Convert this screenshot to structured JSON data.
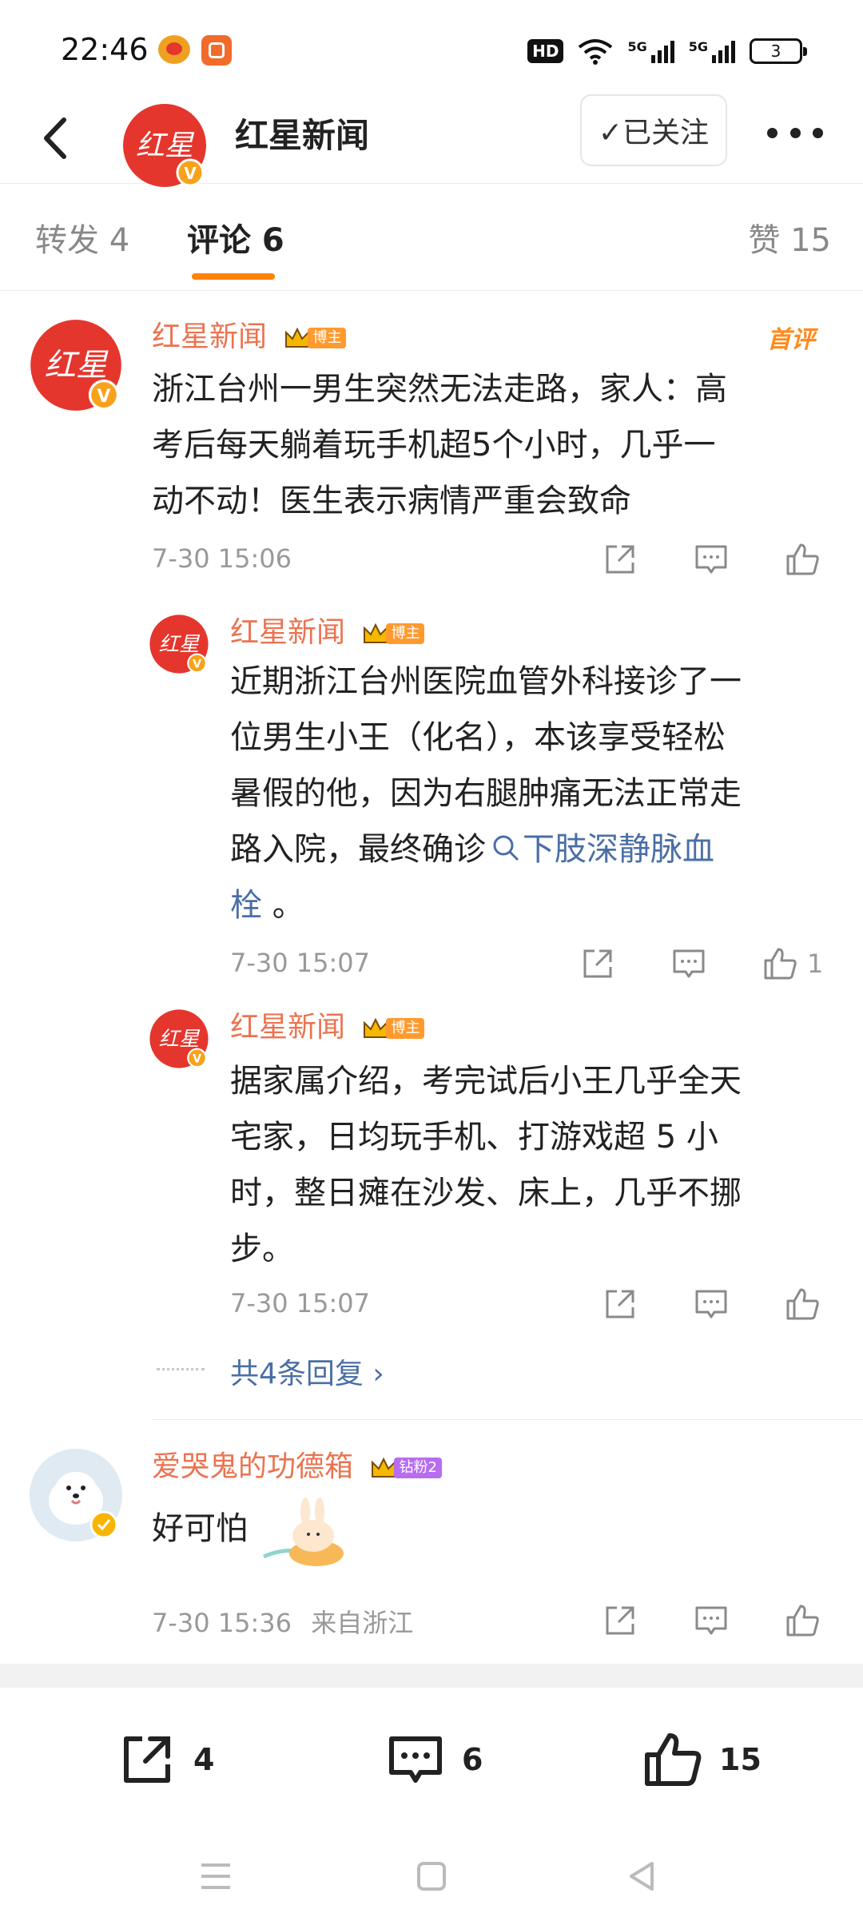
{
  "status_bar": {
    "time": "22:46",
    "hd_label": "HD",
    "net1": "5G",
    "net2": "5G",
    "battery": "3"
  },
  "header": {
    "title": "红星新闻",
    "follow_label": "✓已关注",
    "avatar_text": "红星"
  },
  "tabs": {
    "repost": "转发 4",
    "comment": "评论 6",
    "like": "赞 15"
  },
  "colors": {
    "accent_orange": "#ff8200",
    "username_orange": "#eb7350",
    "link_blue": "#4a6fa5",
    "brand_red": "#e4362d"
  },
  "main_comment": {
    "user": "红星新闻",
    "badge": "博主",
    "first_label": "首评",
    "text_lines": [
      "浙江台州一男生突然无法走路，家人：高",
      "考后每天躺着玩手机超5个小时，几乎一",
      "动不动！医生表示病情严重会致命"
    ],
    "time": "7-30 15:06"
  },
  "reply1": {
    "user": "红星新闻",
    "badge": "博主",
    "text_lines": [
      "近期浙江台州医院血管外科接诊了一",
      "位男生小王（化名），本该享受轻松",
      "暑假的他，因为右腿肿痛无法正常走",
      "路入院，最终确诊"
    ],
    "link_text": "下肢深静脉血",
    "link_text2": "栓",
    "text_end": " 。",
    "time": "7-30 15:07",
    "like_count": "1"
  },
  "reply2": {
    "user": "红星新闻",
    "badge": "博主",
    "text_lines": [
      "据家属介绍，考完试后小王几乎全天",
      "宅家，日均玩手机、打游戏超 5 小",
      "时，整日瘫在沙发、床上，几乎不挪",
      "步。"
    ],
    "time": "7-30 15:07"
  },
  "more_replies": "共4条回复 ›",
  "comment2": {
    "user": "爱哭鬼的功德箱",
    "badge": "钻粉2",
    "text": "好可怕",
    "time": "7-30 15:36",
    "location": "来自浙江"
  },
  "bottom_bar": {
    "repost_count": "4",
    "comment_count": "6",
    "like_count": "15"
  },
  "icons": [
    "back-icon",
    "share-icon",
    "comment-icon",
    "like-icon",
    "more-icon",
    "crown-icon",
    "search-icon",
    "menu-icon",
    "home-icon",
    "back-nav-icon"
  ]
}
